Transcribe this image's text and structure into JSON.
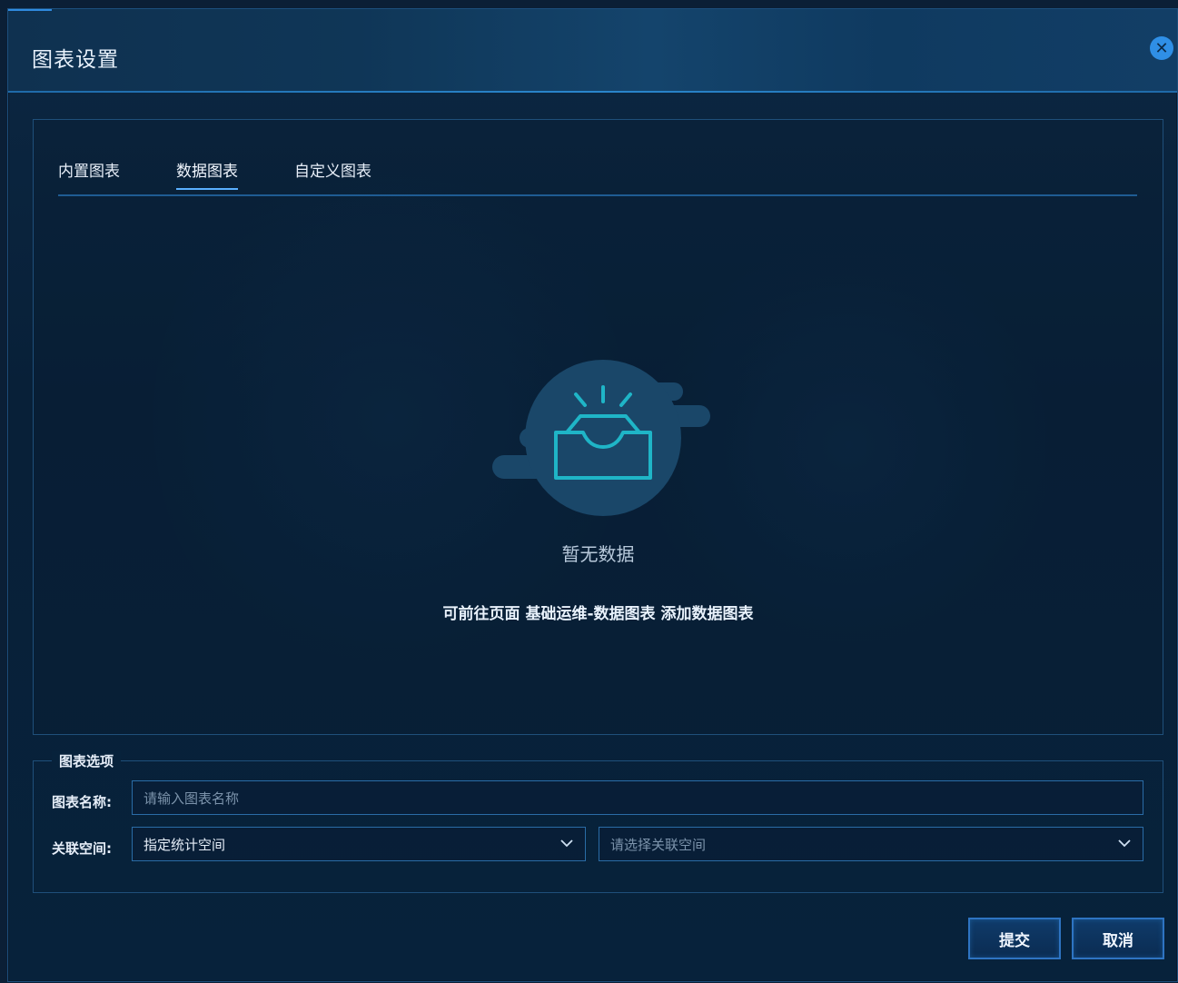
{
  "dialog": {
    "title": "图表设置",
    "close_icon": "close-icon"
  },
  "tabs": [
    {
      "label": "内置图表",
      "active": false
    },
    {
      "label": "数据图表",
      "active": true
    },
    {
      "label": "自定义图表",
      "active": false
    }
  ],
  "empty_state": {
    "icon": "empty-inbox-icon",
    "title": "暂无数据",
    "hint": "可前往页面 基础运维-数据图表 添加数据图表"
  },
  "options": {
    "legend": "图表选项",
    "name_label": "图表名称:",
    "name_placeholder": "请输入图表名称",
    "space_label": "关联空间:",
    "space_mode_value": "指定统计空间",
    "space_select_placeholder": "请选择关联空间"
  },
  "buttons": {
    "submit": "提交",
    "cancel": "取消"
  },
  "colors": {
    "accent": "#2f8be0",
    "background": "#0b1f36",
    "border": "#1f4f7a"
  }
}
